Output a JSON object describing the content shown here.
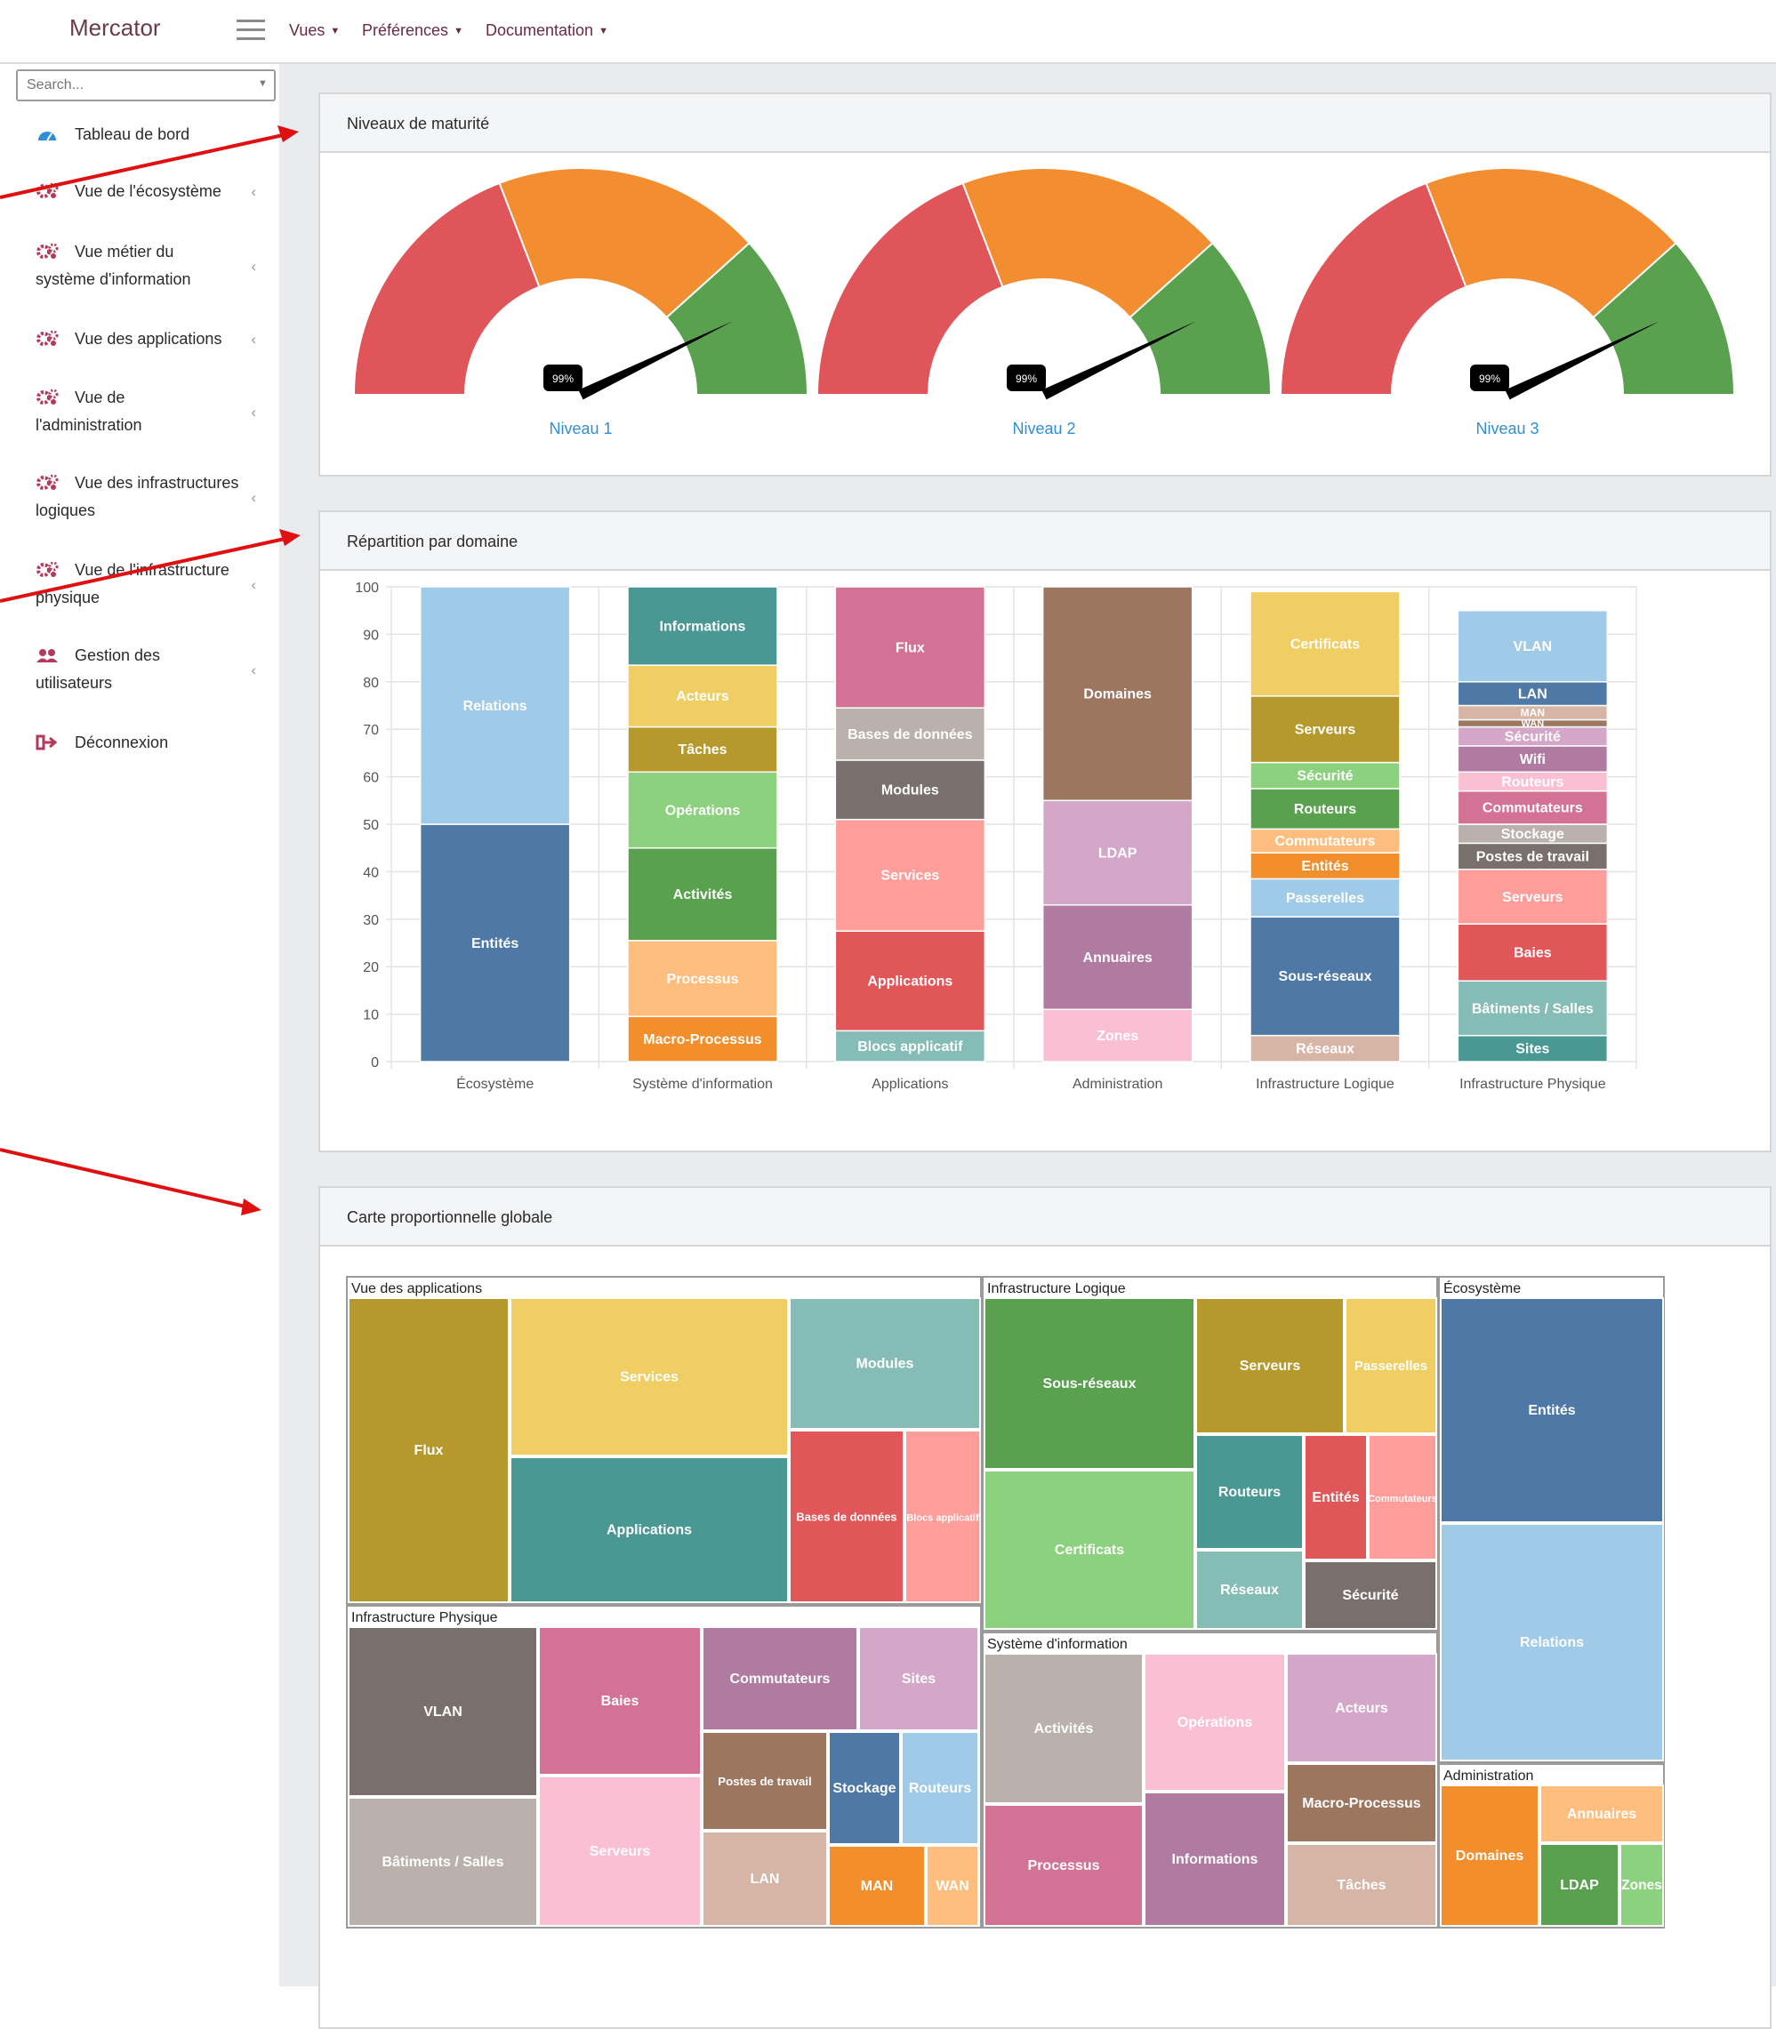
{
  "app": {
    "brand": "Mercator",
    "menus": [
      {
        "label": "Vues"
      },
      {
        "label": "Préférences"
      },
      {
        "label": "Documentation"
      }
    ]
  },
  "sidebar": {
    "search_placeholder": "Search...",
    "items": [
      {
        "label": "Tableau de bord",
        "icon": "dashboard-icon",
        "chevron": false
      },
      {
        "label": "Vue de l'écosystème",
        "icon": "cogs-icon",
        "chevron": true
      },
      {
        "label": "Vue métier du système d'information",
        "icon": "cogs-icon",
        "chevron": true
      },
      {
        "label": "Vue des applications",
        "icon": "cogs-icon",
        "chevron": true
      },
      {
        "label": "Vue de l'administration",
        "icon": "cogs-icon",
        "chevron": true
      },
      {
        "label": "Vue des infrastructures logiques",
        "icon": "cogs-icon",
        "chevron": true
      },
      {
        "label": "Vue de l'infrastructure physique",
        "icon": "cogs-icon",
        "chevron": true
      },
      {
        "label": "Gestion des utilisateurs",
        "icon": "users-icon",
        "chevron": true
      },
      {
        "label": "Déconnexion",
        "icon": "logout-icon",
        "chevron": false
      }
    ]
  },
  "cards": {
    "maturity": {
      "title": "Niveaux de maturité"
    },
    "domains": {
      "title": "Répartition par domaine"
    },
    "treemap": {
      "title": "Carte proportionnelle globale"
    }
  },
  "colors": {
    "gauge_red": "#e05559",
    "gauge_orange": "#f28e2f",
    "gauge_green": "#59a14f",
    "link_blue": "#2f8ed6",
    "arrow_red": "#e01010"
  },
  "gauges": [
    {
      "label": "Niveau 1",
      "value": 99,
      "display": "99%"
    },
    {
      "label": "Niveau 2",
      "value": 99,
      "display": "99%"
    },
    {
      "label": "Niveau 3",
      "value": 99,
      "display": "99%"
    }
  ],
  "chart_data": {
    "type": "bar",
    "stacked": true,
    "ylim": [
      0,
      100
    ],
    "yticks": [
      0,
      10,
      20,
      30,
      40,
      50,
      60,
      70,
      80,
      90,
      100
    ],
    "grid": true,
    "categories": [
      "Écosystème",
      "Système d'information",
      "Applications",
      "Administration",
      "Infrastructure Logique",
      "Infrastructure Physique"
    ],
    "stacks": [
      [
        {
          "name": "Entités",
          "value": 50,
          "color": "#4e79a7"
        },
        {
          "name": "Relations",
          "value": 50,
          "color": "#a0cbe8"
        }
      ],
      [
        {
          "name": "Macro-Processus",
          "value": 9.5,
          "color": "#f28e2b"
        },
        {
          "name": "Processus",
          "value": 16,
          "color": "#ffbe7d"
        },
        {
          "name": "Activités",
          "value": 19.5,
          "color": "#59a14f"
        },
        {
          "name": "Opérations",
          "value": 16,
          "color": "#8cd17d"
        },
        {
          "name": "Tâches",
          "value": 9.5,
          "color": "#b6992d"
        },
        {
          "name": "Acteurs",
          "value": 13,
          "color": "#f1ce63"
        },
        {
          "name": "Informations",
          "value": 16.5,
          "color": "#499894"
        }
      ],
      [
        {
          "name": "Blocs applicatif",
          "value": 6.5,
          "color": "#86bcb6"
        },
        {
          "name": "Applications",
          "value": 21,
          "color": "#e15759"
        },
        {
          "name": "Services",
          "value": 23.5,
          "color": "#ff9d9a"
        },
        {
          "name": "Modules",
          "value": 12.5,
          "color": "#79706e"
        },
        {
          "name": "Bases de données",
          "value": 11,
          "color": "#bab0ac"
        },
        {
          "name": "Flux",
          "value": 25.5,
          "color": "#d37295"
        }
      ],
      [
        {
          "name": "Zones",
          "value": 11,
          "color": "#fabfd2"
        },
        {
          "name": "Annuaires",
          "value": 22,
          "color": "#b07aa1"
        },
        {
          "name": "LDAP",
          "value": 22,
          "color": "#d4a6c8"
        },
        {
          "name": "Domaines",
          "value": 45,
          "color": "#9d7660"
        }
      ],
      [
        {
          "name": "Réseaux",
          "value": 5.5,
          "color": "#d7b5a6"
        },
        {
          "name": "Sous-réseaux",
          "value": 25,
          "color": "#4e79a7"
        },
        {
          "name": "Passerelles",
          "value": 8,
          "color": "#a0cbe8"
        },
        {
          "name": "Entités",
          "value": 5.5,
          "color": "#f28e2b"
        },
        {
          "name": "Commutateurs",
          "value": 5,
          "color": "#ffbe7d"
        },
        {
          "name": "Routeurs",
          "value": 8.5,
          "color": "#59a14f"
        },
        {
          "name": "Sécurité",
          "value": 5.5,
          "color": "#8cd17d"
        },
        {
          "name": "Serveurs",
          "value": 14,
          "color": "#b6992d"
        },
        {
          "name": "Certificats",
          "value": 22,
          "color": "#f1ce63"
        }
      ],
      [
        {
          "name": "Sites",
          "value": 5.5,
          "color": "#499894"
        },
        {
          "name": "Bâtiments / Salles",
          "value": 11.5,
          "color": "#86bcb6"
        },
        {
          "name": "Baies",
          "value": 12,
          "color": "#e15759"
        },
        {
          "name": "Serveurs",
          "value": 11.5,
          "color": "#ff9d9a"
        },
        {
          "name": "Postes de travail",
          "value": 5.5,
          "color": "#79706e"
        },
        {
          "name": "Stockage",
          "value": 4,
          "color": "#bab0ac"
        },
        {
          "name": "Commutateurs",
          "value": 7,
          "color": "#d37295"
        },
        {
          "name": "Routeurs",
          "value": 4,
          "color": "#fabfd2"
        },
        {
          "name": "Wifi",
          "value": 5.5,
          "color": "#b07aa1"
        },
        {
          "name": "Sécurité",
          "value": 4,
          "color": "#d4a6c8"
        },
        {
          "name": "WAN",
          "value": 1.5,
          "color": "#9d7660"
        },
        {
          "name": "MAN",
          "value": 3,
          "color": "#d7b5a6"
        },
        {
          "name": "LAN",
          "value": 5,
          "color": "#4e79a7"
        },
        {
          "name": "VLAN",
          "value": 15,
          "color": "#a0cbe8"
        }
      ]
    ]
  },
  "treemap": {
    "groups": [
      {
        "title": "Vue des applications",
        "cells": [
          {
            "label": "Flux",
            "color": "#b6992d"
          },
          {
            "label": "Services",
            "color": "#f1ce63"
          },
          {
            "label": "Modules",
            "color": "#86bcb6"
          },
          {
            "label": "Applications",
            "color": "#499894"
          },
          {
            "label": "Bases de données",
            "color": "#e15759"
          },
          {
            "label": "Blocs applicatif",
            "color": "#ff9d9a"
          }
        ]
      },
      {
        "title": "Infrastructure Logique",
        "cells": [
          {
            "label": "Sous-réseaux",
            "color": "#59a14f"
          },
          {
            "label": "Serveurs",
            "color": "#b6992d"
          },
          {
            "label": "Passerelles",
            "color": "#f1ce63"
          },
          {
            "label": "Certificats",
            "color": "#8cd17d"
          },
          {
            "label": "Routeurs",
            "color": "#499894"
          },
          {
            "label": "Entités",
            "color": "#e15759"
          },
          {
            "label": "Commutateurs",
            "color": "#ff9d9a"
          },
          {
            "label": "Réseaux",
            "color": "#86bcb6"
          },
          {
            "label": "Sécurité",
            "color": "#79706e"
          }
        ]
      },
      {
        "title": "Écosystème",
        "cells": [
          {
            "label": "Entités",
            "color": "#4e79a7"
          },
          {
            "label": "Relations",
            "color": "#a0cbe8"
          }
        ]
      },
      {
        "title": "Infrastructure Physique",
        "cells": [
          {
            "label": "VLAN",
            "color": "#79706e"
          },
          {
            "label": "Baies",
            "color": "#d37295"
          },
          {
            "label": "Commutateurs",
            "color": "#b07aa1"
          },
          {
            "label": "Sites",
            "color": "#d4a6c8"
          },
          {
            "label": "Bâtiments / Salles",
            "color": "#bab0ac"
          },
          {
            "label": "Serveurs",
            "color": "#fabfd2"
          },
          {
            "label": "Postes de travail",
            "color": "#9d7660"
          },
          {
            "label": "Stockage",
            "color": "#4e79a7"
          },
          {
            "label": "Routeurs",
            "color": "#a0cbe8"
          },
          {
            "label": "LAN",
            "color": "#d7b5a6"
          },
          {
            "label": "MAN",
            "color": "#f28e2b"
          },
          {
            "label": "WAN",
            "color": "#ffbe7d"
          }
        ]
      },
      {
        "title": "Système d'information",
        "cells": [
          {
            "label": "Activités",
            "color": "#bab0ac"
          },
          {
            "label": "Opérations",
            "color": "#fabfd2"
          },
          {
            "label": "Acteurs",
            "color": "#d4a6c8"
          },
          {
            "label": "Macro-Processus",
            "color": "#9d7660"
          },
          {
            "label": "Processus",
            "color": "#d37295"
          },
          {
            "label": "Informations",
            "color": "#b07aa1"
          },
          {
            "label": "Tâches",
            "color": "#d7b5a6"
          }
        ]
      },
      {
        "title": "Administration",
        "cells": [
          {
            "label": "Domaines",
            "color": "#f28e2b"
          },
          {
            "label": "Annuaires",
            "color": "#ffbe7d"
          },
          {
            "label": "LDAP",
            "color": "#59a14f"
          },
          {
            "label": "Zones",
            "color": "#8cd17d"
          }
        ]
      }
    ]
  }
}
